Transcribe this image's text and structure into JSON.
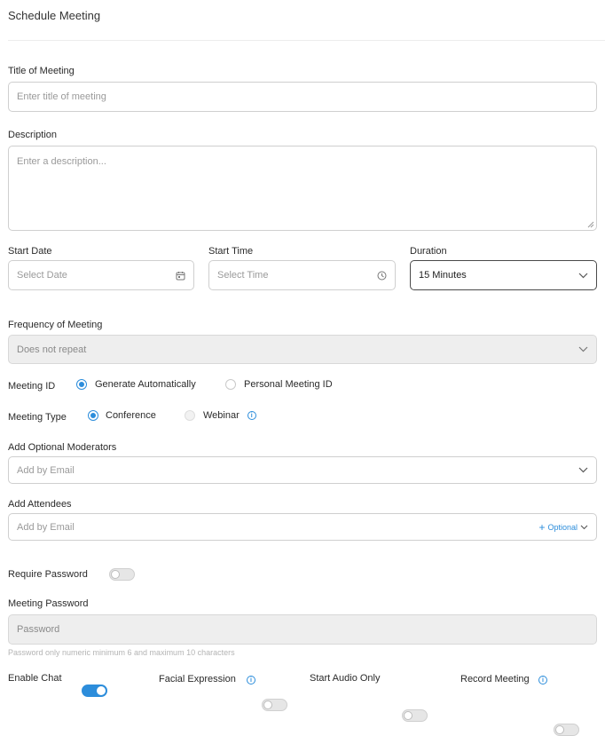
{
  "header": {
    "title": "Schedule Meeting"
  },
  "form": {
    "title_label": "Title of Meeting",
    "title_placeholder": "Enter title of meeting",
    "description_label": "Description",
    "description_placeholder": "Enter a description...",
    "start_date_label": "Start Date",
    "start_date_placeholder": "Select Date",
    "start_time_label": "Start Time",
    "start_time_placeholder": "Select Time",
    "duration_label": "Duration",
    "duration_value": "15 Minutes",
    "frequency_label": "Frequency of Meeting",
    "frequency_value": "Does not repeat",
    "meeting_id_label": "Meeting ID",
    "meeting_id_options": [
      "Generate Automatically",
      "Personal Meeting ID"
    ],
    "meeting_type_label": "Meeting Type",
    "meeting_type_options": [
      "Conference",
      "Webinar"
    ],
    "moderators_label": "Add Optional Moderators",
    "moderators_placeholder": "Add by Email",
    "attendees_label": "Add Attendees",
    "attendees_placeholder": "Add by Email",
    "attendees_optional": "Optional",
    "require_password_label": "Require Password",
    "password_label": "Meeting Password",
    "password_placeholder": "Password",
    "password_hint": "Password only numeric minimum 6 and maximum 10 characters",
    "toggles": {
      "enable_chat": "Enable Chat",
      "facial_expression": "Facial Expression",
      "start_audio_only": "Start Audio Only",
      "record_meeting": "Record Meeting"
    }
  },
  "colors": {
    "accent": "#2c8ddb",
    "border": "#cfcfcf",
    "disabled_bg": "#eeeeee"
  },
  "icons": {
    "calendar": "calendar-icon",
    "clock": "clock-icon",
    "chevron": "chevron-down-icon",
    "info": "info-icon",
    "plus": "plus-icon"
  }
}
